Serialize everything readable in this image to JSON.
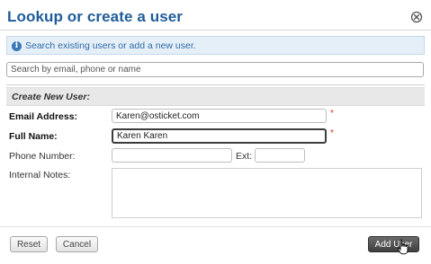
{
  "dialog": {
    "title": "Lookup or create a user"
  },
  "info": {
    "text": "Search existing users or add a new user."
  },
  "search": {
    "placeholder": "Search by email, phone or name"
  },
  "create": {
    "section_title": "Create New User:",
    "email": {
      "label": "Email Address:",
      "value": "Karen@osticket.com",
      "required": true
    },
    "full_name": {
      "label": "Full Name:",
      "value": "Karen Karen",
      "required": true
    },
    "phone": {
      "label": "Phone Number:",
      "value": "",
      "ext_label": "Ext:",
      "ext_value": ""
    },
    "notes": {
      "label": "Internal Notes:",
      "value": ""
    }
  },
  "buttons": {
    "reset": "Reset",
    "cancel": "Cancel",
    "add_user": "Add User"
  },
  "colors": {
    "title": "#1f5c99",
    "info_bg": "#e5eff8",
    "required": "#d9302c",
    "primary_button": "#4a4a4a"
  }
}
